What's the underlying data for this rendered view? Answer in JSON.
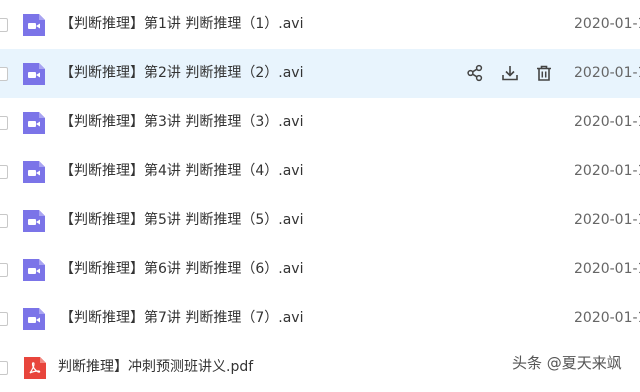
{
  "files": [
    {
      "name": "【判断推理】第1讲 判断推理（1）.avi",
      "date": "2020-01-1",
      "type": "video-icon"
    },
    {
      "name": "【判断推理】第2讲 判断推理（2）.avi",
      "date": "2020-01-1",
      "type": "video-icon"
    },
    {
      "name": "【判断推理】第3讲 判断推理（3）.avi",
      "date": "2020-01-1",
      "type": "video-icon"
    },
    {
      "name": "【判断推理】第4讲 判断推理（4）.avi",
      "date": "2020-01-1",
      "type": "video-icon"
    },
    {
      "name": "【判断推理】第5讲 判断推理（5）.avi",
      "date": "2020-01-1",
      "type": "video-icon"
    },
    {
      "name": "【判断推理】第6讲 判断推理（6）.avi",
      "date": "2020-01-1",
      "type": "video-icon"
    },
    {
      "name": "【判断推理】第7讲 判断推理（7）.avi",
      "date": "2020-01-1",
      "type": "video-icon"
    },
    {
      "name": "判断推理】冲刺预测班讲义.pdf",
      "date": "",
      "type": "pdf-icon"
    }
  ],
  "row_actions": [
    "share-icon",
    "download-icon",
    "delete-icon"
  ],
  "watermark": "头条 @夏天来飒",
  "colors": {
    "video_icon": "#7b74e8",
    "pdf_icon": "#e8453c",
    "hover_row": "#e8f4fd",
    "action_icon": "#444444"
  }
}
